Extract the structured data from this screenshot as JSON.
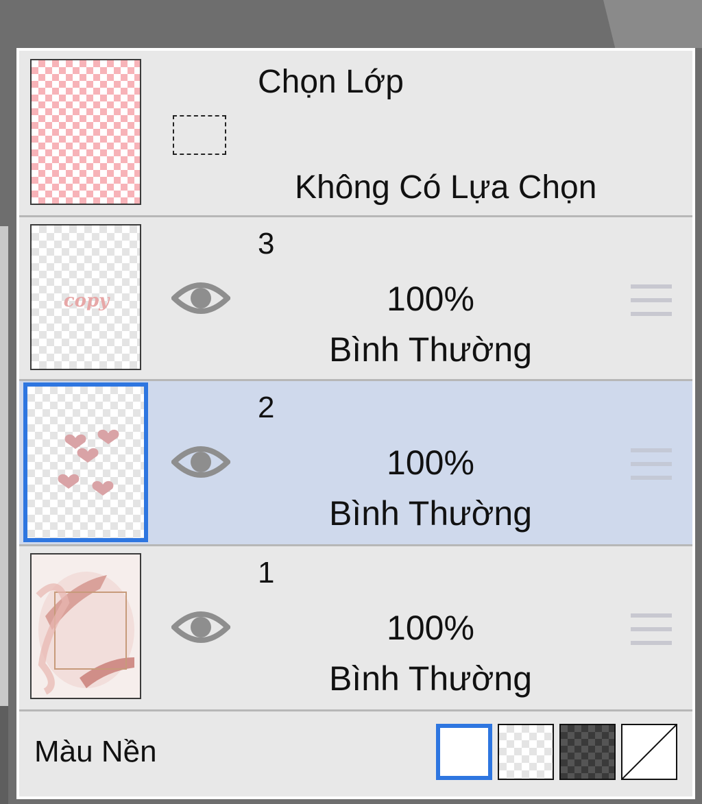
{
  "selection_row": {
    "title": "Chọn Lớp",
    "status": "Không Có Lựa Chọn"
  },
  "layers": [
    {
      "name": "3",
      "opacity": "100%",
      "blend": "Bình Thường",
      "selected": false,
      "thumb_text": "copy"
    },
    {
      "name": "2",
      "opacity": "100%",
      "blend": "Bình Thường",
      "selected": true
    },
    {
      "name": "1",
      "opacity": "100%",
      "blend": "Bình Thường",
      "selected": false
    }
  ],
  "footer": {
    "label": "Màu Nền",
    "swatches": [
      "white",
      "transparent-light",
      "transparent-dark",
      "none"
    ],
    "active_swatch": "white"
  },
  "colors": {
    "accent": "#2e76e0",
    "selected_row": "#cfd9ec",
    "panel_bg": "#e8e8e8",
    "eye": "#8e8e8e",
    "menu_lines": "#c8c8d0"
  }
}
